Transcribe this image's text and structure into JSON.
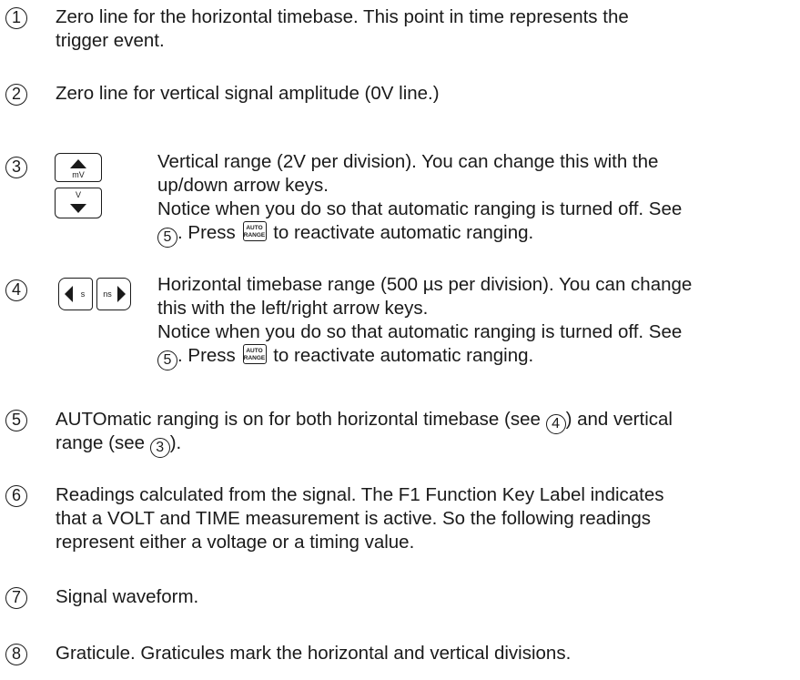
{
  "items": [
    {
      "num": "1",
      "lines": [
        "Zero line for the horizontal timebase. This point in time represents the",
        "trigger event."
      ]
    },
    {
      "num": "2",
      "lines": [
        "Zero line for vertical signal amplitude (0V line.)"
      ]
    },
    {
      "num": "3",
      "lines": [
        "Vertical range (2V per division). You can change this with the",
        "up/down arrow keys.",
        "Notice when you do so that automatic ranging is turned off. See"
      ],
      "see_ref": "5",
      "press_text": ". Press",
      "after_key": "to reactivate automatic ranging."
    },
    {
      "num": "4",
      "lines": [
        "Horizontal timebase range (500 µs per division). You can change",
        "this with the left/right arrow keys.",
        "Notice when you do so that automatic ranging is turned off. See"
      ],
      "see_ref": "5",
      "press_text": ". Press",
      "after_key": "to reactivate automatic ranging."
    },
    {
      "num": "5",
      "line1_a": "AUTOmatic ranging is on for both horizontal timebase (see",
      "ref1": "4",
      "line1_b": ") and vertical",
      "line2_a": "range (see",
      "ref2": "3",
      "line2_b": ")."
    },
    {
      "num": "6",
      "lines": [
        "Readings calculated from the signal. The F1 Function Key Label indicates",
        "that a VOLT and TIME measurement is active. So the following readings",
        "represent either a voltage or a timing value."
      ]
    },
    {
      "num": "7",
      "lines": [
        "Signal waveform."
      ]
    },
    {
      "num": "8",
      "lines": [
        "Graticule. Graticules mark the horizontal and vertical divisions."
      ]
    }
  ],
  "keys": {
    "up_label": "mV",
    "down_label": "V",
    "left_label": "s",
    "right_label": "ns",
    "auto_line1": "AUTO",
    "auto_line2": "RANGE"
  }
}
